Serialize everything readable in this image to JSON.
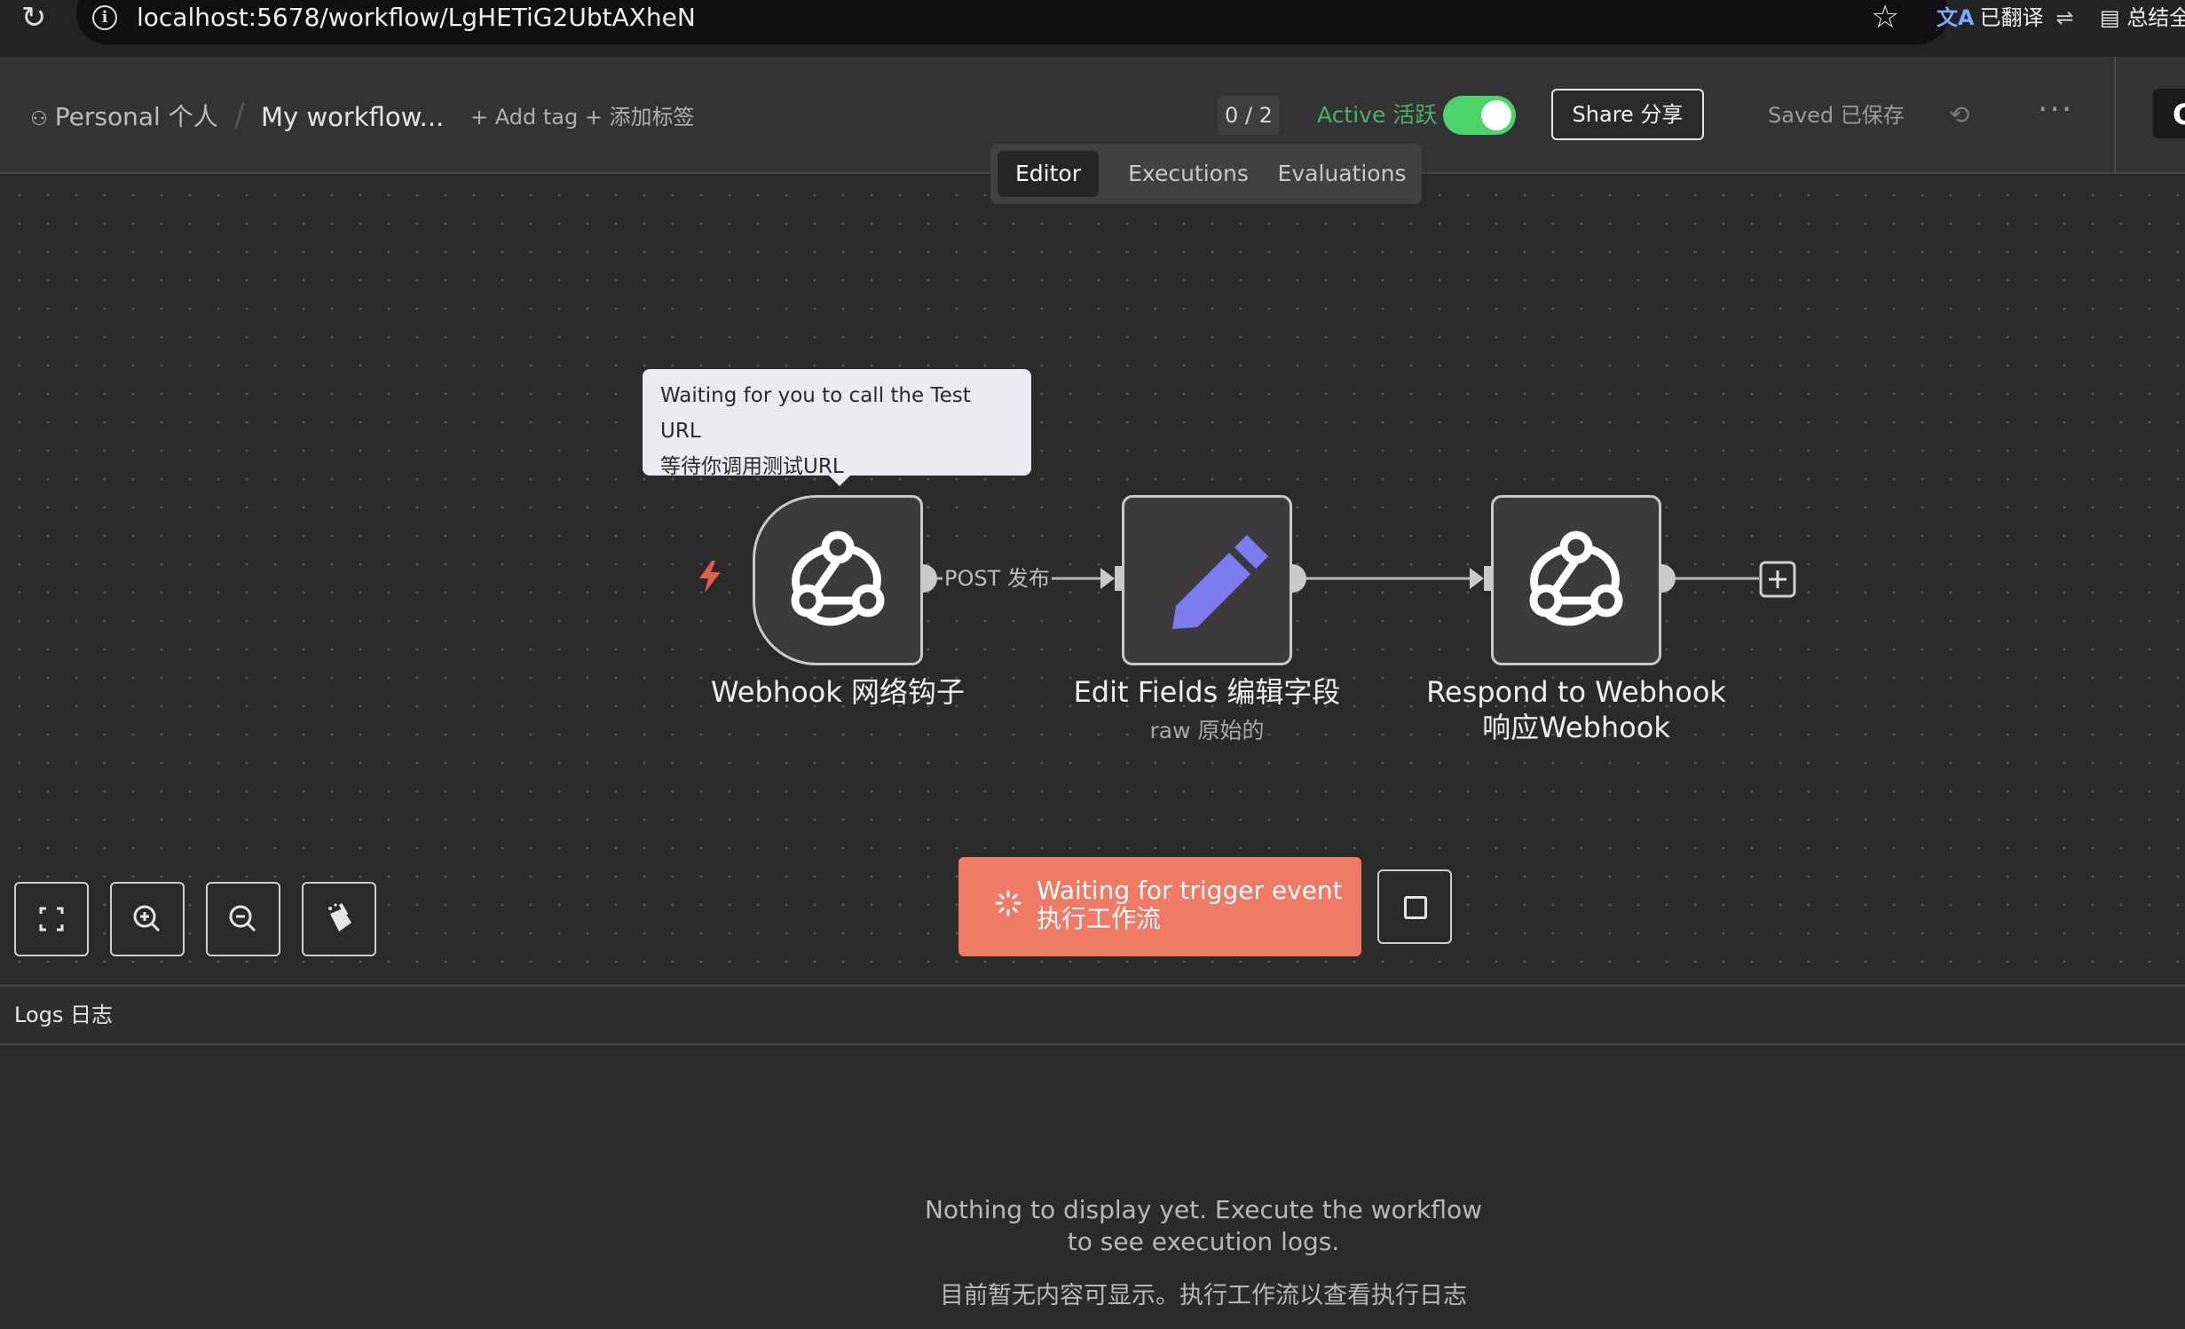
{
  "browser": {
    "url": "localhost:5678/workflow/LgHETiG2UbtAXheN",
    "translate_label": "已翻译",
    "summary_label": "总结全"
  },
  "header": {
    "personal": "Personal 个人",
    "workflow_name": "My workflow...",
    "add_tag": "+ Add tag + 添加标签",
    "counter": "0 / 2",
    "active_label": "Active 活跃",
    "active_on": true,
    "share": "Share 分享",
    "saved": "Saved 已保存"
  },
  "tabs": [
    {
      "label": "Editor",
      "active": true
    },
    {
      "label": "Executions",
      "active": false
    },
    {
      "label": "Evaluations",
      "active": false
    }
  ],
  "tooltip": {
    "line1": "Waiting for you to call the Test URL",
    "line2": "等待你调用测试URL"
  },
  "nodes": [
    {
      "id": "webhook",
      "label": "Webhook 网络钩子",
      "icon": "webhook-icon"
    },
    {
      "id": "edit-fields",
      "label": "Edit Fields 编辑字段",
      "subtitle": "raw 原始的",
      "icon": "pencil-icon"
    },
    {
      "id": "respond",
      "label_line1": "Respond to Webhook",
      "label_line2": "响应Webhook",
      "icon": "webhook-icon"
    }
  ],
  "edge_label": "POST 发布",
  "run_button": {
    "line1": "Waiting for trigger event",
    "line2": "执行工作流"
  },
  "logs": {
    "title": "Logs 日志",
    "empty_en": "Nothing to display yet. Execute the workflow to see execution logs.",
    "empty_zh": "目前暂无内容可显示。执行工作流以查看执行日志"
  },
  "colors": {
    "accent_run": "#ef7b66",
    "active_green": "#4cd46a",
    "pencil_purple": "#7c7cf0",
    "bolt_red": "#e0604c"
  }
}
